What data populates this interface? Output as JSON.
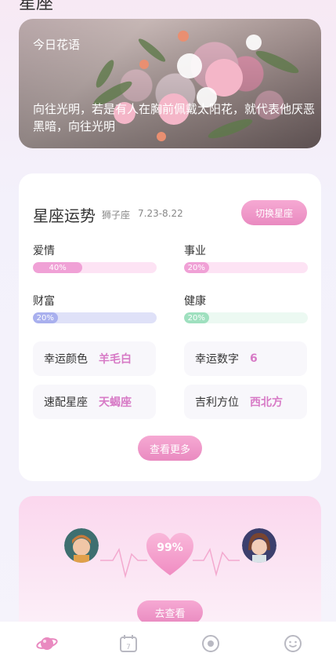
{
  "page": {
    "title": "星座"
  },
  "hero": {
    "label": "今日花语",
    "quote": "向往光明，若是有人在胸前佩戴太阳花，就代表他厌恶黑暗，向往光明"
  },
  "fortune": {
    "title": "星座运势",
    "sign": "狮子座",
    "date_range": "7.23-8.22",
    "switch_label": "切换星座",
    "stats": [
      {
        "label": "爱情",
        "percent_text": "40%",
        "value": 40,
        "color": "#f0a1d6",
        "track": "#fde3f4"
      },
      {
        "label": "事业",
        "percent_text": "20%",
        "value": 20,
        "color": "#f0a1d6",
        "track": "#fde3f4"
      },
      {
        "label": "财富",
        "percent_text": "20%",
        "value": 20,
        "color": "#a9b0ee",
        "track": "#dfe1f8"
      },
      {
        "label": "健康",
        "percent_text": "20%",
        "value": 20,
        "color": "#9fe0bf",
        "track": "#ecf9f2"
      }
    ],
    "lucky_color_label": "幸运颜色",
    "lucky_color": "羊毛白",
    "lucky_number_label": "幸运数字",
    "lucky_number": "6",
    "match_label": "速配星座",
    "match_sign": "天蝎座",
    "direction_label": "吉利方位",
    "direction": "西北方",
    "more_label": "查看更多"
  },
  "match": {
    "percent": "99%",
    "button_label": "去查看"
  },
  "tabbar": {
    "icons": [
      "planet-icon",
      "calendar-icon",
      "record-icon",
      "smiley-icon"
    ],
    "calendar_day": "7",
    "accent": "#e98ac0"
  }
}
